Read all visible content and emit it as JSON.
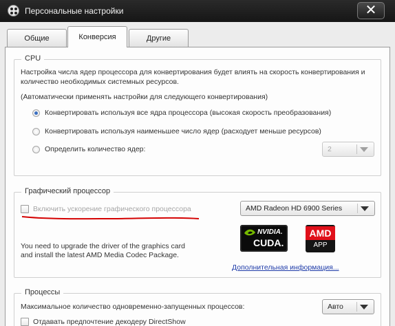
{
  "window": {
    "title": "Персональные настройки",
    "close_label": "✕"
  },
  "tabs": [
    {
      "label": "Общие",
      "active": false
    },
    {
      "label": "Конверсия",
      "active": true
    },
    {
      "label": "Другие",
      "active": false
    }
  ],
  "cpu": {
    "legend": "CPU",
    "description_line1": "Настройка числа ядер процессора для конвертирования будет влиять на скорость конвертирования и",
    "description_line2": "количество необходимых системных ресурсов.",
    "auto_note": "(Автоматически применять настройки для следующего конвертирования)",
    "options": [
      {
        "label": "Конвертировать используя все ядра процессора (высокая скорость преобразования)",
        "selected": true
      },
      {
        "label": "Конвертировать используя наименьшее число ядер (расходует меньше ресурсов)",
        "selected": false
      },
      {
        "label": "Определить количество ядер:",
        "selected": false
      }
    ],
    "cores_value": "2"
  },
  "gpu": {
    "legend": "Графический процессор",
    "enable_label": "Включить ускорение графического процессора",
    "enable_checked": false,
    "device_value": "AMD Radeon HD 6900 Series",
    "warning_line1": "You need to upgrade the driver of the graphics card",
    "warning_line2": "and install the latest AMD Media Codec Package.",
    "more_info_link": "Дополнительная информация...",
    "nvidia_logo": {
      "brand": "NVIDIA.",
      "product": "CUDA."
    },
    "amd_logo": {
      "brand": "AMD",
      "product": "APP"
    },
    "annotation_color": "#d40000"
  },
  "processes": {
    "legend": "Процессы",
    "max_label": "Максимальное количество одновременно-запущенных процессов:",
    "max_value": "Авто",
    "prefer_decoder_label": "Отдавать предпочтение декодеру DirectShow",
    "prefer_decoder_checked": false
  },
  "colors": {
    "titlebar": "#1a1a1a",
    "link": "#1d3aa8",
    "radio_selected": "#3b6fc0"
  }
}
